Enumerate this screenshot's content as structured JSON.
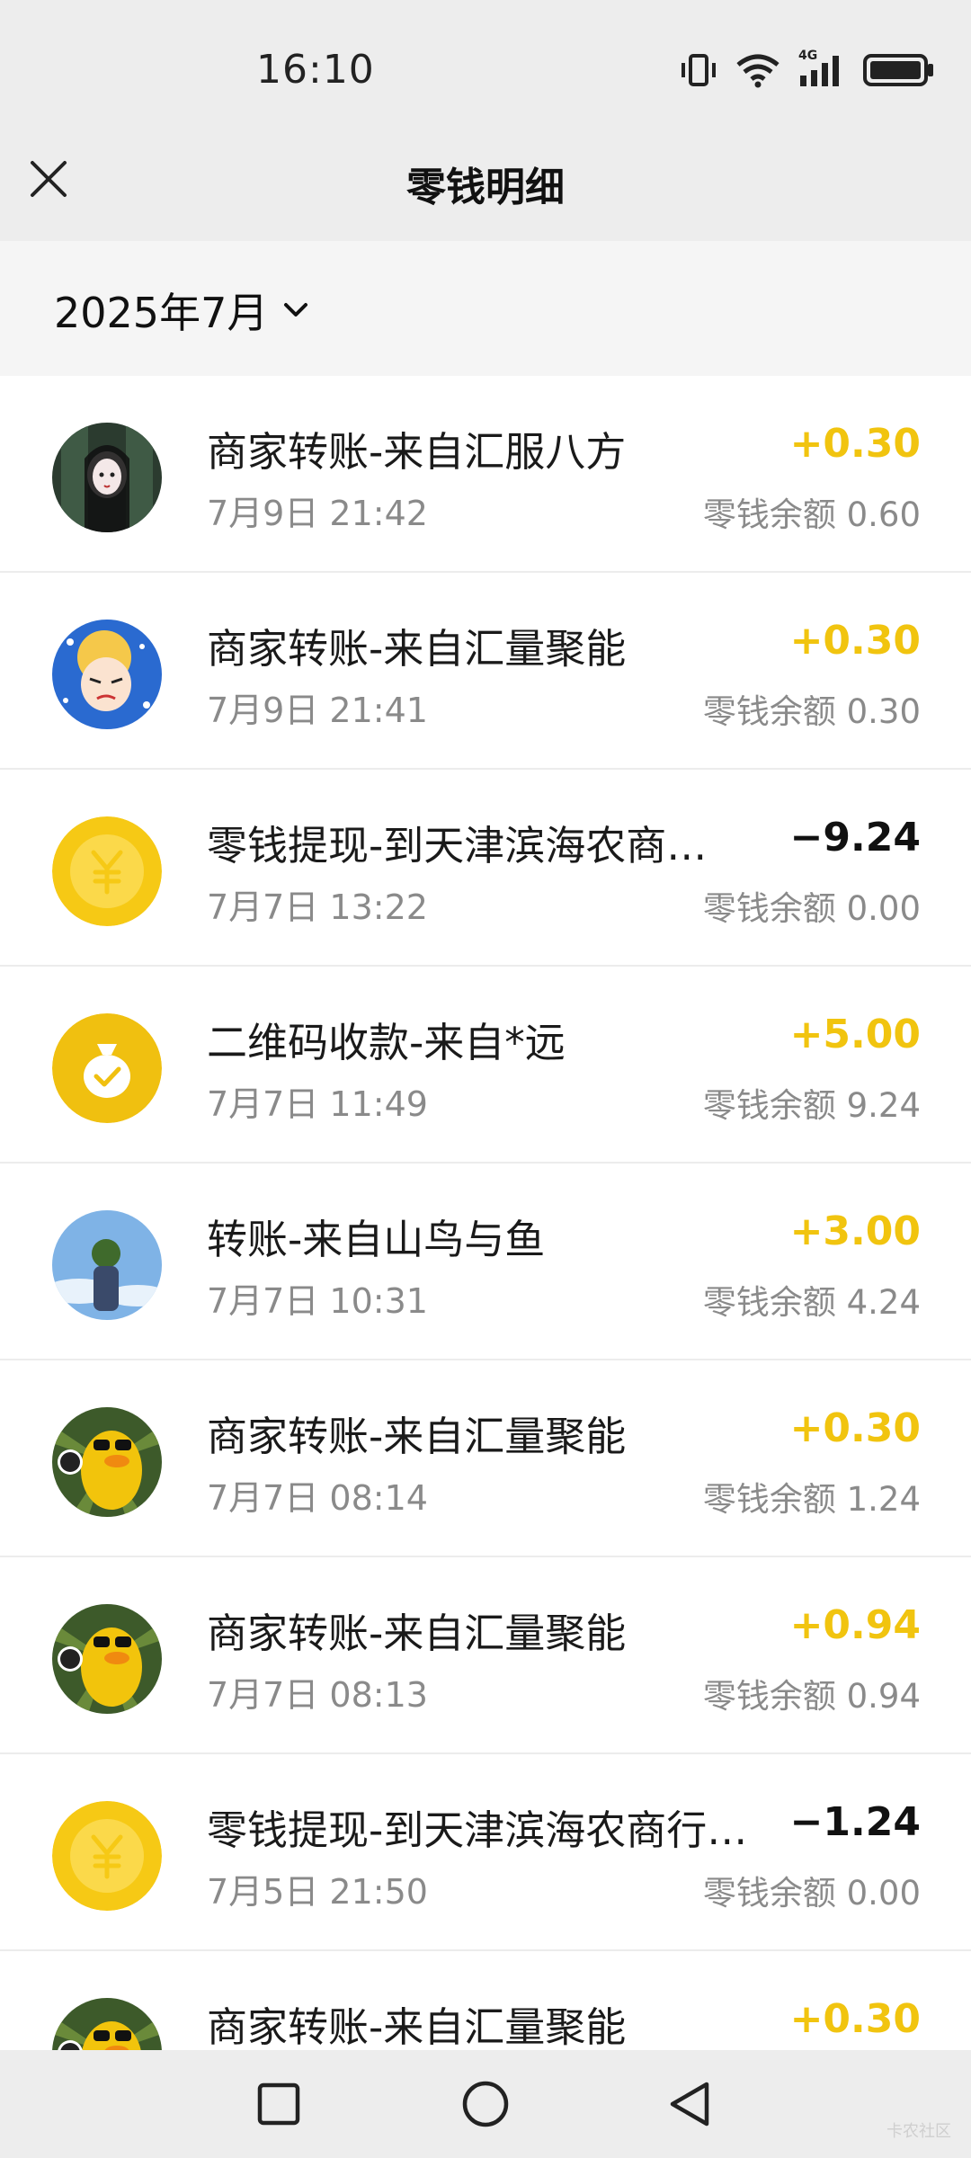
{
  "status_bar": {
    "time": "16:10",
    "icons": [
      "vibrate-icon",
      "wifi-icon",
      "4g-signal-icon",
      "battery-icon"
    ],
    "network_label": "4G"
  },
  "header": {
    "title": "零钱明细",
    "close_icon": "close-icon"
  },
  "filter": {
    "month": "2025年7月",
    "chevron_icon": "chevron-down-icon"
  },
  "colors": {
    "positive_amount": "#f1c40f",
    "negative_amount": "#111111",
    "coin_yellow": "#f6c915"
  },
  "transactions": [
    {
      "title": "商家转账-来自汇服八方",
      "time": "7月9日 21:42",
      "amount": "+0.30",
      "balance": "零钱余额 0.60",
      "avatar": "dark-girl-avatar",
      "sign": "plus"
    },
    {
      "title": "商家转账-来自汇量聚能",
      "time": "7月9日 21:41",
      "amount": "+0.30",
      "balance": "零钱余额 0.30",
      "avatar": "cartoon-avatar",
      "sign": "plus"
    },
    {
      "title": "零钱提现-到天津滨海农商…",
      "time": "7月7日 13:22",
      "amount": "−9.24",
      "balance": "零钱余额 0.00",
      "avatar": "yuan-coin-icon",
      "sign": "minus"
    },
    {
      "title": "二维码收款-来自*远",
      "time": "7月7日 11:49",
      "amount": "+5.00",
      "balance": "零钱余额 9.24",
      "avatar": "money-bag-icon",
      "sign": "plus"
    },
    {
      "title": "转账-来自山鸟与鱼",
      "time": "7月7日 10:31",
      "amount": "+3.00",
      "balance": "零钱余额 4.24",
      "avatar": "sky-photo-avatar",
      "sign": "plus"
    },
    {
      "title": "商家转账-来自汇量聚能",
      "time": "7月7日 08:14",
      "amount": "+0.30",
      "balance": "零钱余额 1.24",
      "avatar": "duck-avatar",
      "sign": "plus"
    },
    {
      "title": "商家转账-来自汇量聚能",
      "time": "7月7日 08:13",
      "amount": "+0.94",
      "balance": "零钱余额 0.94",
      "avatar": "duck-avatar",
      "sign": "plus"
    },
    {
      "title": "零钱提现-到天津滨海农商行…",
      "time": "7月5日 21:50",
      "amount": "−1.24",
      "balance": "零钱余额 0.00",
      "avatar": "yuan-coin-icon",
      "sign": "minus"
    },
    {
      "title": "商家转账-来自汇量聚能",
      "time": "",
      "amount": "+0.30",
      "balance": "",
      "avatar": "duck-avatar",
      "sign": "plus"
    }
  ],
  "nav": {
    "recents_icon": "square-icon",
    "home_icon": "circle-icon",
    "back_icon": "triangle-back-icon"
  },
  "watermark": "卡农社区"
}
